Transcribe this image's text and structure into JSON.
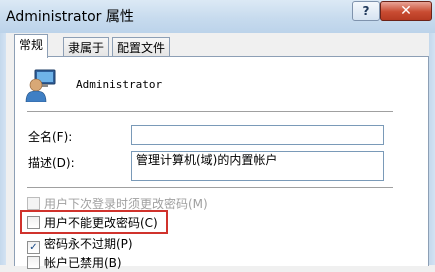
{
  "window": {
    "title": "Administrator 属性",
    "help_label": "?",
    "close_label": "✕"
  },
  "tabs": [
    {
      "label": "常规",
      "active": true
    },
    {
      "label": "隶属于",
      "active": false
    },
    {
      "label": "配置文件",
      "active": false
    }
  ],
  "general": {
    "username": "Administrator",
    "full_name_label": "全名(F):",
    "full_name_value": "",
    "description_label": "描述(D):",
    "description_value": "管理计算机(域)的内置帐户",
    "options": [
      {
        "label": "用户下次登录时须更改密码(M)",
        "checked": false,
        "disabled": true
      },
      {
        "label": "用户不能更改密码(C)",
        "checked": false,
        "disabled": false
      },
      {
        "label": "密码永不过期(P)",
        "checked": true,
        "disabled": false
      },
      {
        "label": "帐户已禁用(B)",
        "checked": false,
        "disabled": false
      }
    ],
    "check_glyph": "✓"
  },
  "colors": {
    "highlight": "#d0322c",
    "close": "#c94c32"
  }
}
